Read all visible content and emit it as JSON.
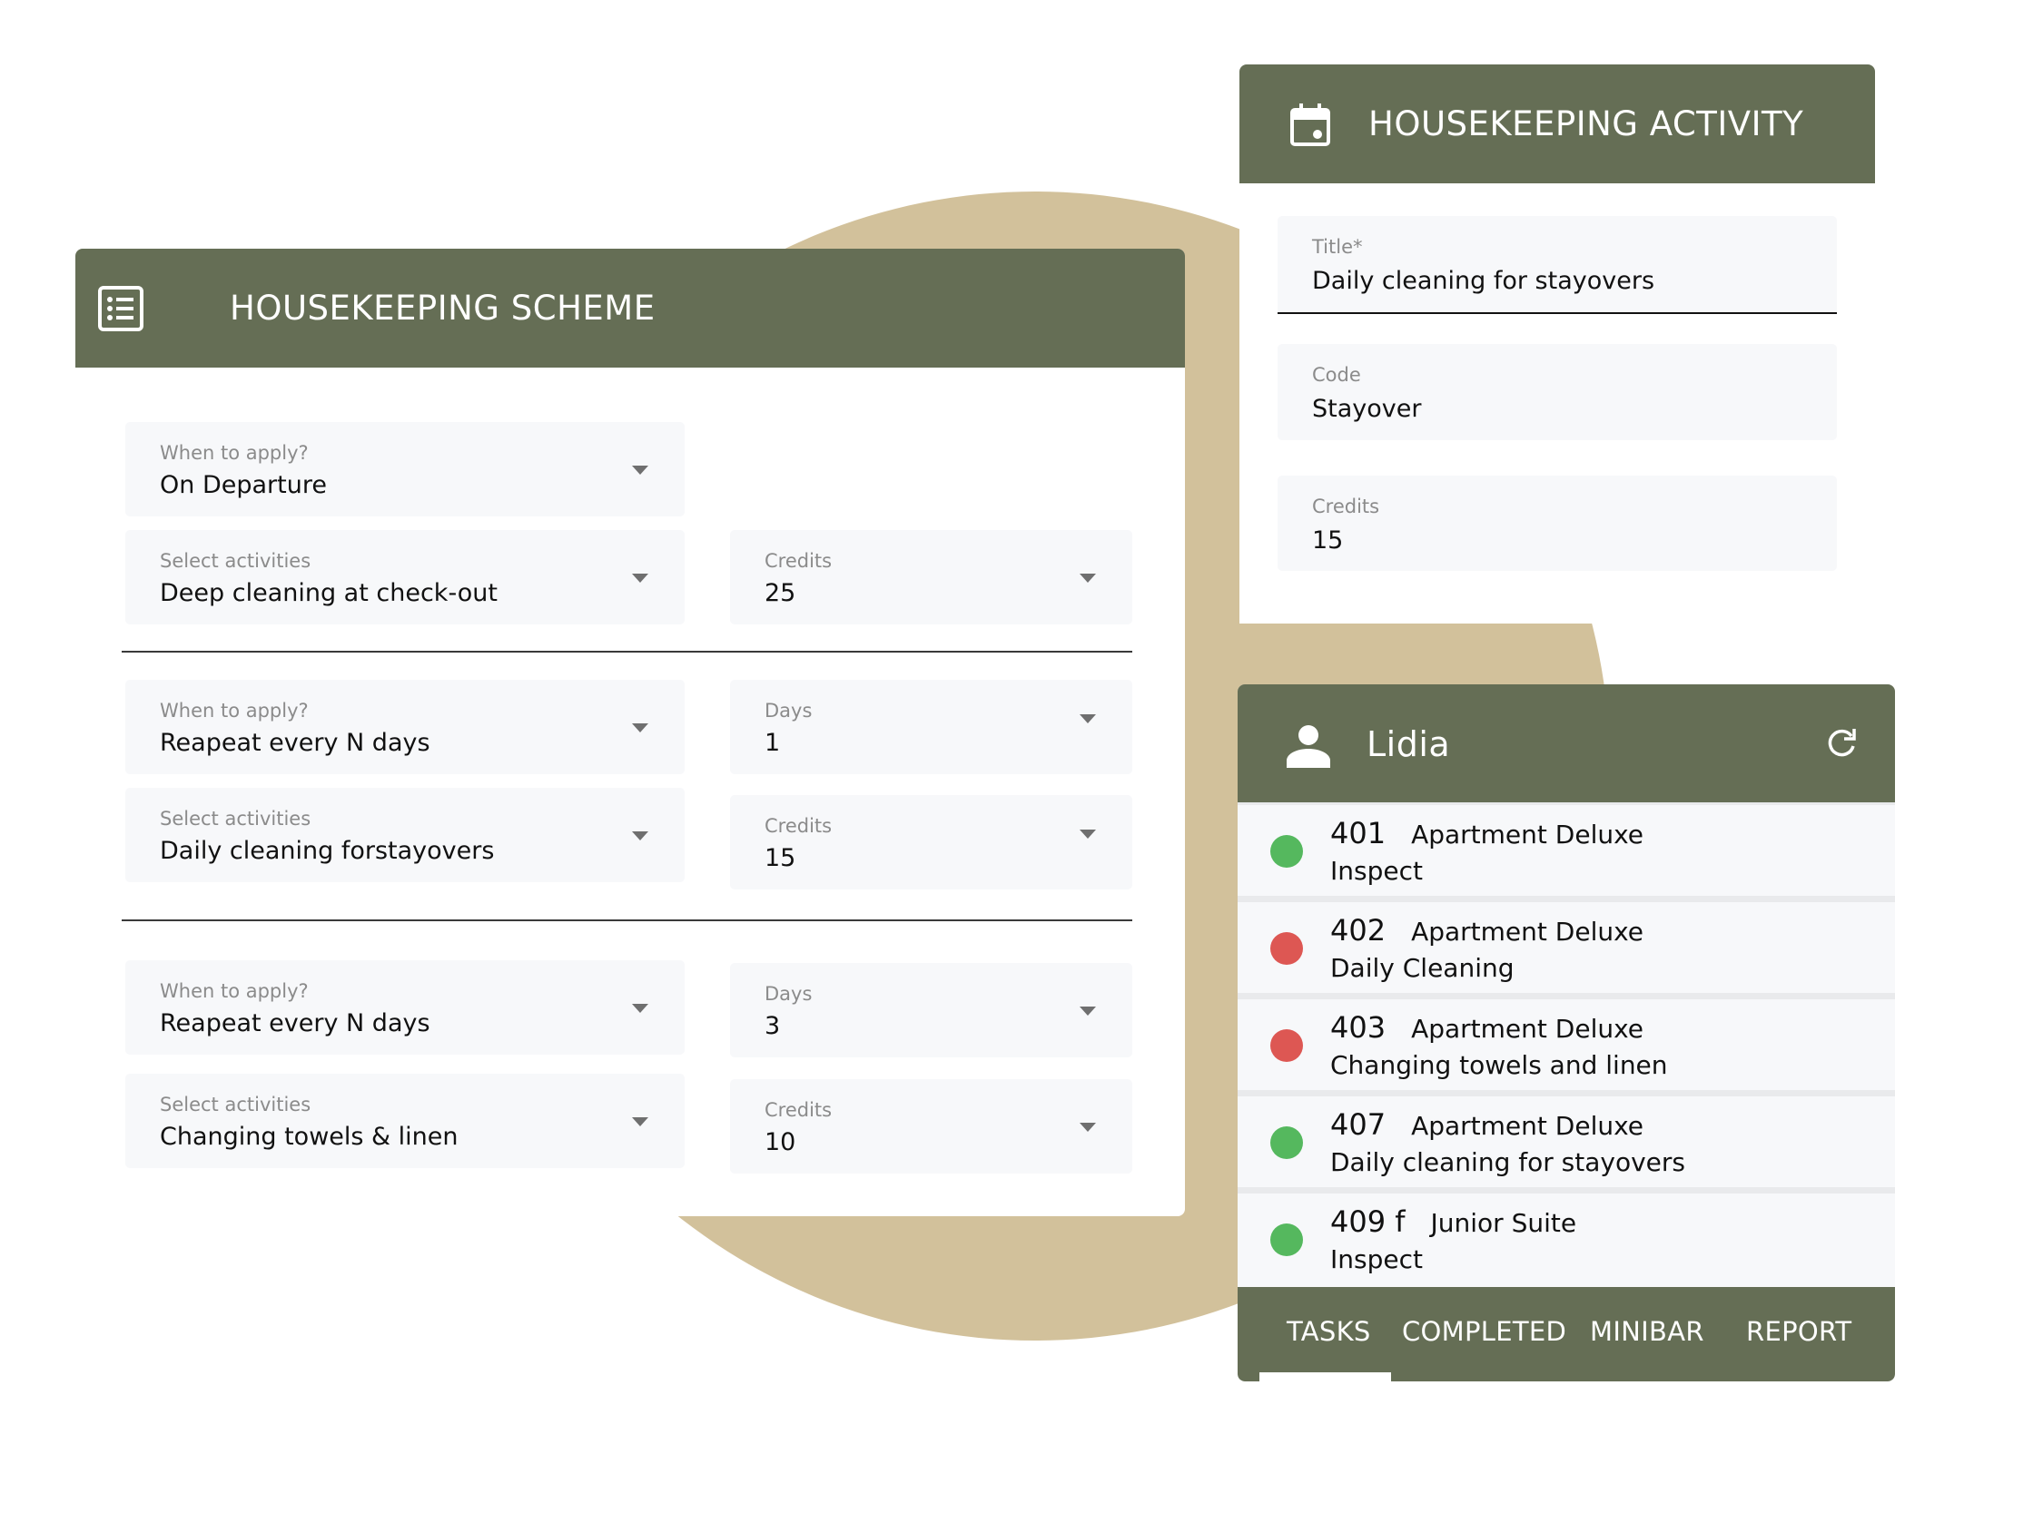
{
  "colors": {
    "header_bg": "#656e55",
    "accent_shape": "#d2c19b",
    "status_done": "#55b85e",
    "status_pending": "#dd5753"
  },
  "scheme": {
    "title": "HOUSEKEEPING SCHEME",
    "icon": "list-icon",
    "groups": [
      {
        "when_label": "When to apply?",
        "when_value": "On Departure",
        "activity_label": "Select activities",
        "activity_value": "Deep cleaning at check-out",
        "credits_label": "Credits",
        "credits_value": "25"
      },
      {
        "when_label": "When to apply?",
        "when_value": "Reapeat every N days",
        "days_label": "Days",
        "days_value": "1",
        "activity_label": "Select activities",
        "activity_value": "Daily cleaning forstayovers",
        "credits_label": "Credits",
        "credits_value": "15"
      },
      {
        "when_label": "When to apply?",
        "when_value": "Reapeat every N days",
        "days_label": "Days",
        "days_value": "3",
        "activity_label": "Select activities",
        "activity_value": "Changing towels & linen",
        "credits_label": "Credits",
        "credits_value": "10"
      }
    ]
  },
  "activity": {
    "title": "HOUSEKEEPING ACTIVITY",
    "icon": "calendar-icon",
    "fields": [
      {
        "label": "Title*",
        "value": "Daily cleaning for stayovers"
      },
      {
        "label": "Code",
        "value": "Stayover"
      },
      {
        "label": "Credits",
        "value": "15"
      }
    ]
  },
  "staff": {
    "name": "Lidia",
    "icon": "person-icon",
    "refresh_icon": "refresh-icon",
    "rooms": [
      {
        "number": "401",
        "type": "Apartment Deluxe",
        "task": "Inspect",
        "status": "done"
      },
      {
        "number": "402",
        "type": "Apartment Deluxe",
        "task": "Daily Cleaning",
        "status": "pending"
      },
      {
        "number": "403",
        "type": "Apartment Deluxe",
        "task": "Changing towels and linen",
        "status": "pending"
      },
      {
        "number": "407",
        "type": "Apartment Deluxe",
        "task": "Daily cleaning for stayovers",
        "status": "done"
      },
      {
        "number": "409 f",
        "type": "Junior Suite",
        "task": "Inspect",
        "status": "done"
      }
    ],
    "tabs": [
      {
        "label": "TASKS",
        "active": true
      },
      {
        "label": "COMPLETED",
        "active": false
      },
      {
        "label": "MINIBAR",
        "active": false
      },
      {
        "label": "REPORT",
        "active": false
      }
    ]
  }
}
